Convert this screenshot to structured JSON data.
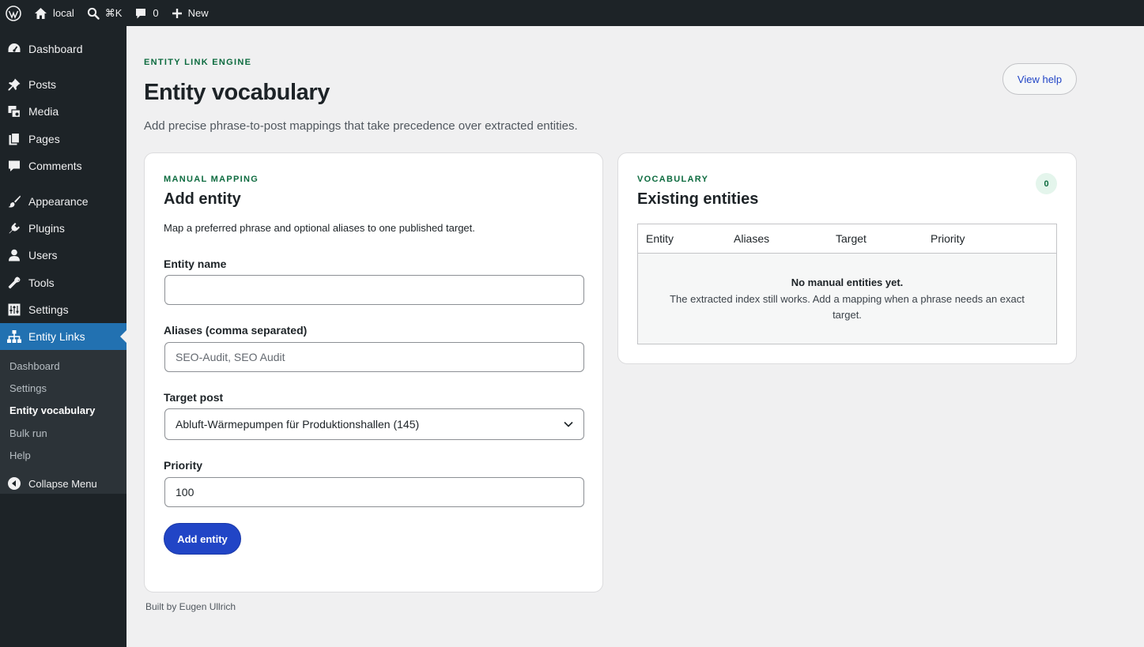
{
  "adminbar": {
    "site_name": "local",
    "search_shortcut": "⌘K",
    "comments_count": "0",
    "new_label": "New"
  },
  "sidebar": {
    "items": [
      {
        "label": "Dashboard",
        "icon": "dashboard-icon"
      },
      {
        "label": "Posts",
        "icon": "pin-icon"
      },
      {
        "label": "Media",
        "icon": "media-icon"
      },
      {
        "label": "Pages",
        "icon": "pages-icon"
      },
      {
        "label": "Comments",
        "icon": "comment-icon"
      },
      {
        "label": "Appearance",
        "icon": "brush-icon"
      },
      {
        "label": "Plugins",
        "icon": "plug-icon"
      },
      {
        "label": "Users",
        "icon": "user-icon"
      },
      {
        "label": "Tools",
        "icon": "wrench-icon"
      },
      {
        "label": "Settings",
        "icon": "settings-icon"
      },
      {
        "label": "Entity Links",
        "icon": "sitemap-icon"
      }
    ],
    "submenu": [
      "Dashboard",
      "Settings",
      "Entity vocabulary",
      "Bulk run",
      "Help"
    ],
    "collapse_label": "Collapse Menu"
  },
  "page": {
    "eyebrow": "ENTITY LINK ENGINE",
    "title": "Entity vocabulary",
    "description": "Add precise phrase-to-post mappings that take precedence over extracted entities.",
    "help_button": "View help"
  },
  "add_card": {
    "eyebrow": "MANUAL MAPPING",
    "title": "Add entity",
    "description": "Map a preferred phrase and optional aliases to one published target.",
    "entity_name_label": "Entity name",
    "entity_name_value": "",
    "aliases_label": "Aliases (comma separated)",
    "aliases_placeholder": "SEO-Audit, SEO Audit",
    "target_label": "Target post",
    "target_value": "Abluft-Wärmepumpen für Produktionshallen (145)",
    "priority_label": "Priority",
    "priority_value": "100",
    "submit_label": "Add entity"
  },
  "vocab_card": {
    "eyebrow": "VOCABULARY",
    "title": "Existing entities",
    "count": "0",
    "columns": [
      "Entity",
      "Aliases",
      "Target",
      "Priority"
    ],
    "empty_title": "No manual entities yet.",
    "empty_desc": "The extracted index still works. Add a mapping when a phrase needs an exact target."
  },
  "footer": "Built by Eugen Ullrich",
  "colors": {
    "accent": "#2145c6",
    "wp_blue": "#2271b1",
    "eyebrow_green": "#0d6b3f",
    "admin_dark": "#1d2327"
  }
}
